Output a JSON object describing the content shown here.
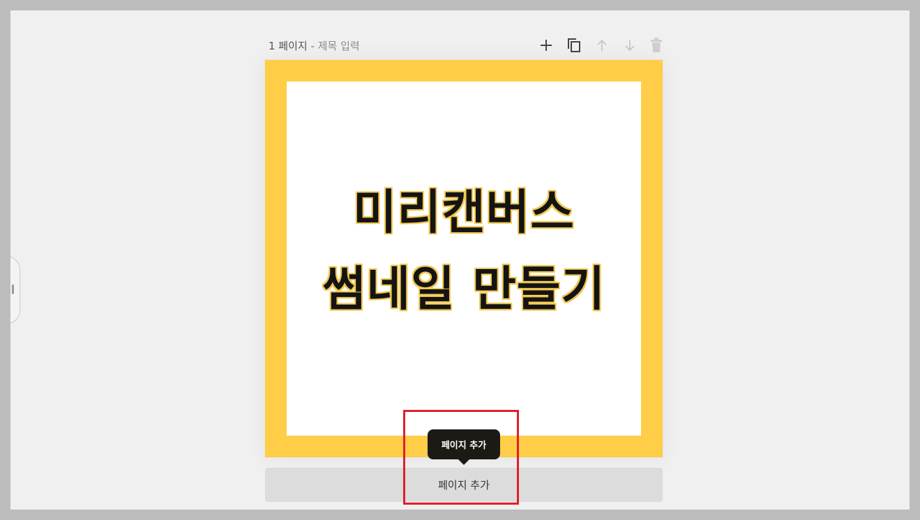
{
  "page_header": {
    "page_number_label": "1 페이지",
    "separator": "-",
    "title_placeholder": "제목 입력"
  },
  "toolbar": {
    "icons": [
      "plus-icon",
      "copy-icon",
      "arrow-up-icon",
      "arrow-down-icon",
      "trash-icon"
    ]
  },
  "canvas": {
    "line1": "미리캔버스",
    "line2": "썸네일 만들기",
    "border_color": "#ffcd48",
    "inner_color": "#ffffff"
  },
  "tooltip": {
    "text": "페이지 추가"
  },
  "add_page": {
    "label": "페이지 추가"
  },
  "colors": {
    "highlight": "#e0202a",
    "tooltip_bg": "#1c1a15"
  }
}
